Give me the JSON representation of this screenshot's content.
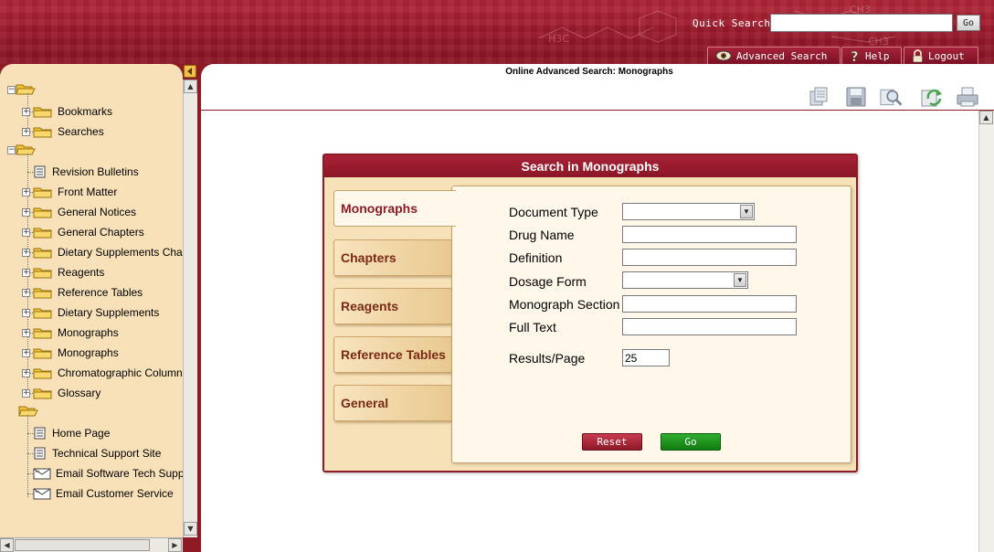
{
  "header": {
    "quick_search_label": "Quick Search",
    "quick_search_value": "",
    "quick_search_go": "Go",
    "buttons": {
      "advanced_search": "Advanced Search",
      "help": "Help",
      "logout": "Logout"
    }
  },
  "sidebar": {
    "groups": [
      {
        "items": [
          "Bookmarks",
          "Searches"
        ]
      },
      {
        "items": [
          "Revision Bulletins",
          "Front Matter",
          "General Notices",
          "General Chapters",
          "Dietary Supplements Chapters",
          "Reagents",
          "Reference Tables",
          "Dietary Supplements",
          "Monographs",
          "Monographs",
          "Chromatographic Columns",
          "Glossary"
        ]
      },
      {
        "items": [
          "Home Page",
          "Technical Support Site",
          "Email Software Tech Support",
          "Email Customer Service"
        ]
      }
    ]
  },
  "main": {
    "title": "Online Advanced Search: Monographs",
    "panel": {
      "title": "Search in Monographs",
      "tabs": [
        "Monographs",
        "Chapters",
        "Reagents",
        "Reference Tables",
        "General"
      ],
      "active_tab": "Monographs",
      "fields": {
        "document_type": {
          "label": "Document Type",
          "value": ""
        },
        "drug_name": {
          "label": "Drug Name",
          "value": ""
        },
        "definition": {
          "label": "Definition",
          "value": ""
        },
        "dosage_form": {
          "label": "Dosage Form",
          "value": ""
        },
        "monograph_section": {
          "label": "Monograph Section",
          "value": ""
        },
        "full_text": {
          "label": "Full Text",
          "value": ""
        },
        "results_per_page": {
          "label": "Results/Page",
          "value": "25"
        }
      },
      "reset_label": "Reset",
      "go_label": "Go"
    }
  },
  "colors": {
    "brand": "#8e1a26",
    "sidebar_bg": "#f8e1b8",
    "tab_text": "#7a2a14",
    "go_green": "#1a8a1a"
  },
  "icons": {
    "toolbar": [
      "copy-icon",
      "save-icon",
      "preview-icon",
      "refresh-icon",
      "print-icon"
    ],
    "tree_folder": "folder-icon",
    "tree_document": "document-icon",
    "tree_email": "email-icon"
  }
}
